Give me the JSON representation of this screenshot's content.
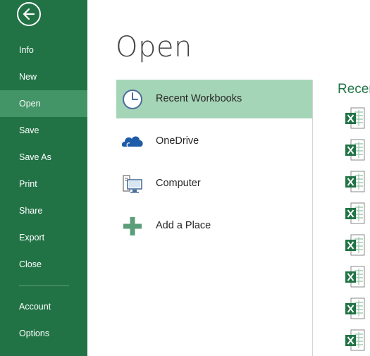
{
  "sidebar": {
    "back_label": "Back",
    "items": [
      {
        "label": "Info"
      },
      {
        "label": "New"
      },
      {
        "label": "Open",
        "active": true
      },
      {
        "label": "Save"
      },
      {
        "label": "Save As"
      },
      {
        "label": "Print"
      },
      {
        "label": "Share"
      },
      {
        "label": "Export"
      },
      {
        "label": "Close"
      },
      {
        "label": "Account"
      },
      {
        "label": "Options"
      }
    ]
  },
  "main": {
    "title": "Open",
    "places": [
      {
        "label": "Recent Workbooks",
        "icon": "clock-icon",
        "active": true
      },
      {
        "label": "OneDrive",
        "icon": "cloud-icon"
      },
      {
        "label": "Computer",
        "icon": "computer-icon"
      },
      {
        "label": "Add a Place",
        "icon": "plus-icon"
      }
    ],
    "recent_heading": "Recen",
    "recent_files_icon": "excel-file-icon"
  },
  "colors": {
    "sidebar_bg": "#217346",
    "sidebar_active": "#439467",
    "place_active": "#a5d5b7",
    "accent": "#217346"
  }
}
